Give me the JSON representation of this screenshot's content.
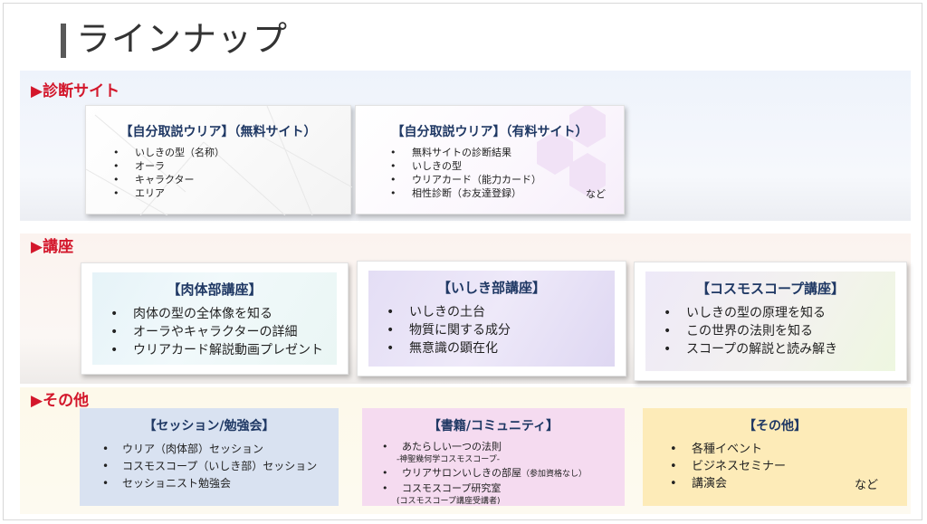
{
  "title": "ラインナップ",
  "bullet": "•",
  "sections": {
    "diagnosis": "▶診断サイト",
    "courses": "▶講座",
    "other": "▶その他"
  },
  "diagnosis": {
    "free": {
      "title": "【自分取説ウリア】（無料サイト）",
      "items": [
        "いしきの型（名称）",
        "オーラ",
        "キャラクター",
        "エリア"
      ]
    },
    "paid": {
      "title": "【自分取説ウリア】（有料サイト）",
      "items": [
        "無料サイトの診断結果",
        "いしきの型",
        "ウリアカード（能力カード）",
        "相性診断（お友達登録）"
      ],
      "suffix": "など"
    }
  },
  "courses": {
    "body": {
      "title": "【肉体部講座】",
      "items": [
        "肉体の型の全体像を知る",
        "オーラやキャラクターの詳細",
        "ウリアカード解説動画プレゼント"
      ]
    },
    "ishiki": {
      "title": "【いしき部講座】",
      "items": [
        "いしきの土台",
        "物質に関する成分",
        "無意識の顕在化"
      ]
    },
    "cosmoscope": {
      "title": "【コスモスコープ講座】",
      "items": [
        "いしきの型の原理を知る",
        "この世界の法則を知る",
        "スコープの解説と読み解き"
      ]
    }
  },
  "other": {
    "session": {
      "title": "【セッション/勉強会】",
      "items": [
        "ウリア（肉体部）セッション",
        "コスモスコープ（いしき部）セッション",
        "セッショニスト勉強会"
      ]
    },
    "books": {
      "title": "【書籍/コミュニティ】",
      "item1": "あたらしい一つの法則",
      "item1_sub": "-神聖幾何学コスモスコープ-",
      "item2": "ウリアサロンいしきの部屋",
      "item2_note": "（参加資格なし）",
      "item3": "コスモスコープ研究室",
      "item3_sub": "(コスモスコープ講座受講者)"
    },
    "misc": {
      "title": "【その他】",
      "items": [
        "各種イベント",
        "ビジネスセミナー",
        "講演会"
      ],
      "suffix": "など"
    }
  }
}
